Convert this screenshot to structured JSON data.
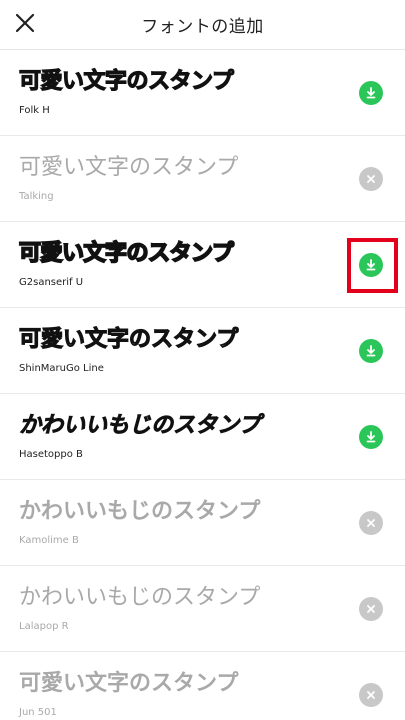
{
  "header": {
    "title": "フォントの追加",
    "close_icon": "close-icon"
  },
  "fonts": [
    {
      "sample": "可愛い文字のスタンプ",
      "name": "Folk H",
      "state": "download"
    },
    {
      "sample": "可愛い文字のスタンプ",
      "name": "Talking",
      "state": "installed"
    },
    {
      "sample": "可愛い文字のスタンプ",
      "name": "G2sanserif U",
      "state": "download"
    },
    {
      "sample": "可愛い文字のスタンプ",
      "name": "ShinMaruGo Line",
      "state": "download"
    },
    {
      "sample": "かわいいもじのスタンプ",
      "name": "Hasetoppo B",
      "state": "download"
    },
    {
      "sample": "かわいいもじのスタンプ",
      "name": "Kamolime B",
      "state": "installed"
    },
    {
      "sample": "かわいいもじのスタンプ",
      "name": "Lalapop R",
      "state": "installed"
    },
    {
      "sample": "可愛い文字のスタンプ",
      "name": "Jun 501",
      "state": "installed"
    }
  ],
  "colors": {
    "download": "#2bc659",
    "remove": "#c8c8c8",
    "highlight": "#e3001b"
  }
}
